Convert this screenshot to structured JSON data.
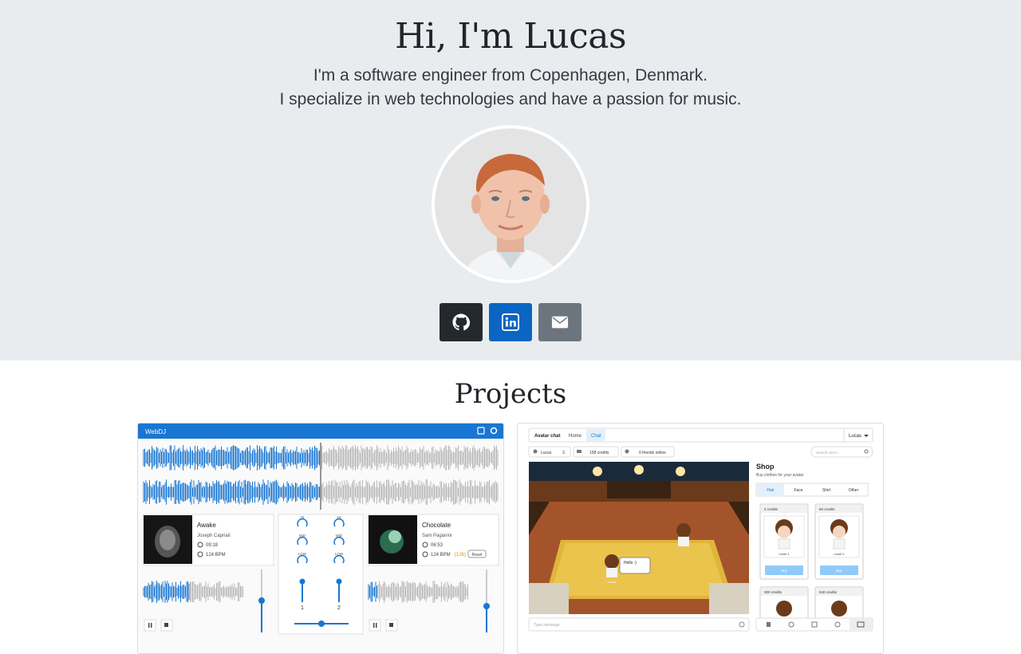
{
  "hero": {
    "title": "Hi, I'm Lucas",
    "subtitle_line1": "I'm a software engineer from Copenhagen, Denmark.",
    "subtitle_line2": "I specialize in web technologies and have a passion for music.",
    "avatar_icon": "profile-photo",
    "socials": [
      {
        "name": "github",
        "icon": "github-icon",
        "color": "#24292e"
      },
      {
        "name": "linkedin",
        "icon": "linkedin-icon",
        "color": "#0a66c2"
      },
      {
        "name": "email",
        "icon": "envelope-icon",
        "color": "#6c757d"
      }
    ],
    "background": "#e9ecef"
  },
  "projects": {
    "title": "Projects",
    "webdj": {
      "app_title": "WebDJ",
      "deck_a": {
        "track": "Awake",
        "artist": "Joseph Capriati",
        "duration": "09:18",
        "bpm": "124 BPM"
      },
      "deck_b": {
        "track": "Chocolate",
        "artist": "Sam Paganini",
        "duration": "06:53",
        "bpm": "124 BPM",
        "pitch": "(126)",
        "reset": "Reset"
      },
      "eq_labels": {
        "hi": "HI",
        "mid": "MID",
        "low": "LOW"
      },
      "channel_1": "1",
      "channel_2": "2",
      "accent": "#1976d2"
    },
    "avatar_chat": {
      "nav": {
        "brand": "Avatar chat",
        "home": "Home",
        "chat": "Chat",
        "user": "Lucas"
      },
      "stats": {
        "user": "Lucas",
        "level": "3",
        "credits": "158 credits",
        "friends": "0 friends online"
      },
      "search_placeholder": "Search users...",
      "shop": {
        "title": "Shop",
        "subtitle": "Buy clothes for your avatar",
        "tabs": [
          "Hair",
          "Face",
          "Shirt",
          "Other"
        ],
        "items": [
          {
            "price": "0 credits",
            "name": "Level 1",
            "buy": "Buy"
          },
          {
            "price": "60 credits",
            "name": "Level 2",
            "buy": "Buy"
          },
          {
            "price": "300 credits"
          },
          {
            "price": "540 credits"
          }
        ]
      },
      "chat_bubble": "Hello :)",
      "npc_name": "Lucas",
      "message_placeholder": "Type message"
    }
  }
}
